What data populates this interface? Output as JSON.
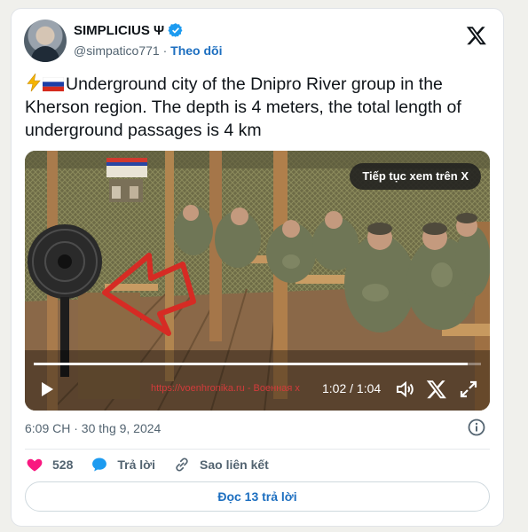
{
  "author": {
    "name": "SIMPLICIUS Ψ",
    "handle": "@simpatico771",
    "separator": "·",
    "follow_label": "Theo dõi"
  },
  "tweet": {
    "text": "Underground city of the Dnipro River group in the Kherson region. The depth is 4 meters, the total length of underground passages is 4 km"
  },
  "video": {
    "continue_label": "Tiếp tục xem trên X",
    "time": "1:02 / 1:04",
    "progress": 0.97,
    "watermark": "https://voenhronika.ru - Военная х"
  },
  "meta": {
    "timestamp": "6:09 CH · 30 thg 9, 2024"
  },
  "actions": {
    "like_count": "528",
    "reply_label": "Trả lời",
    "copy_label": "Sao liên kết"
  },
  "read_replies_label": "Đọc 13 trả lời",
  "colors": {
    "accent": "#1d6fc0",
    "like": "#f91880",
    "verified": "#1d9bf0"
  }
}
